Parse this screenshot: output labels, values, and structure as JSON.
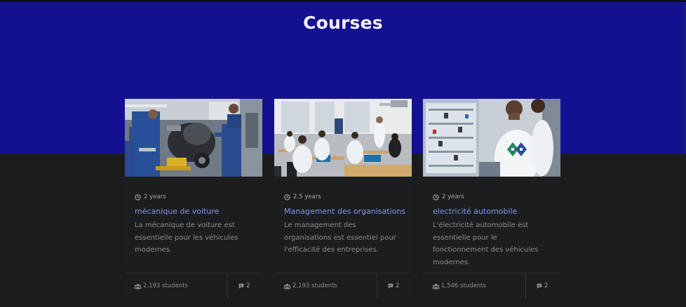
{
  "page": {
    "title": "Courses"
  },
  "courses": [
    {
      "duration": "2 years",
      "title": "mécanique de voiture",
      "description": "La mécanique de voiture est essentielle pour les véhicules modernes.",
      "students": "2,193 students",
      "comments": "2",
      "image_icon": "engine-workshop-image"
    },
    {
      "duration": "2.5 years",
      "title": "Management des organisations",
      "description": "Le management des organisations est essentiel pour l'efficacité des entreprises.",
      "students": "2,193 students",
      "comments": "2",
      "image_icon": "classroom-image"
    },
    {
      "duration": "2 years",
      "title": "electricité automobile",
      "description": "L'électricité automobile est essentielle pour le fonctionnement des véhicules modernes.",
      "students": "1,546 students",
      "comments": "2",
      "image_icon": "electrical-lab-image"
    }
  ],
  "icons": {
    "duration": "clock-icon",
    "students": "users-icon",
    "comments": "comment-icon"
  },
  "colors": {
    "hero": "#141191",
    "background": "#1b1c1e",
    "title_link": "#7d98e8"
  }
}
